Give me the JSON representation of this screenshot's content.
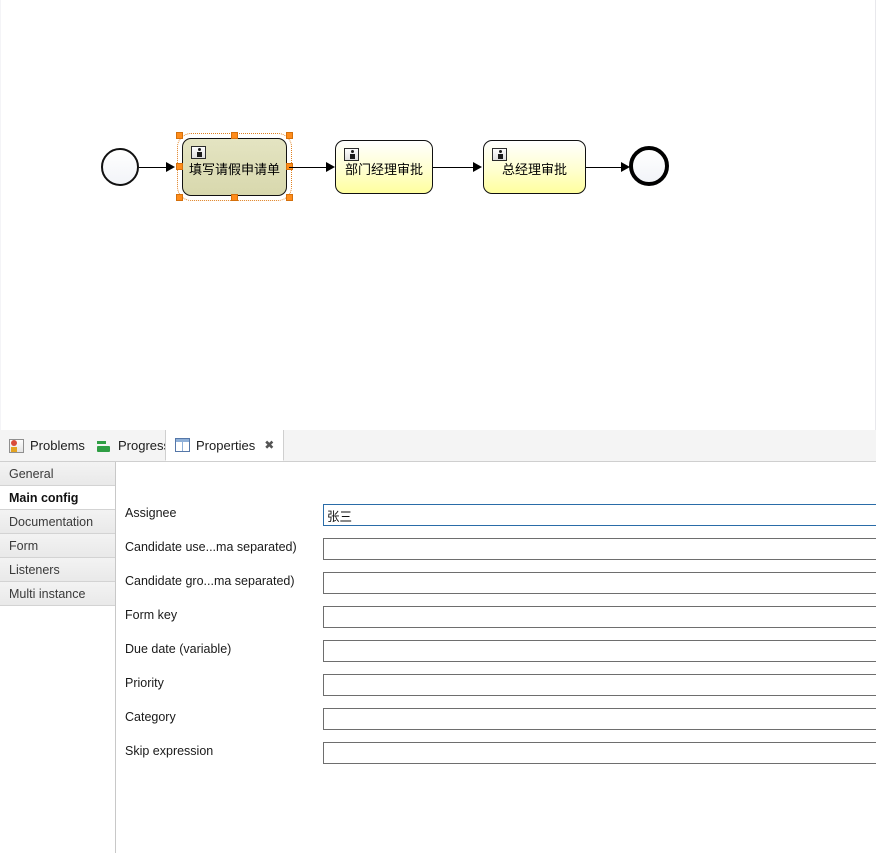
{
  "canvas": {
    "name": "bpmn-process-diagram",
    "start_event": {
      "label": "",
      "icon": "start-event-icon"
    },
    "end_event": {
      "label": "",
      "icon": "end-event-icon"
    },
    "tasks": [
      {
        "label": "填写请假申请单",
        "icon": "user-task-icon",
        "selected": true
      },
      {
        "label": "部门经理审批",
        "icon": "user-task-icon",
        "selected": false
      },
      {
        "label": "总经理审批",
        "icon": "user-task-icon",
        "selected": false
      }
    ],
    "colors": {
      "task_fill_top": "#ffffff",
      "task_fill_bottom": "#ffff9e",
      "task_selected_fill": "#d8d8ad",
      "selection_handle": "#ff8c1a",
      "connector": "#000000"
    }
  },
  "tabs": [
    {
      "label": "Problems",
      "icon": "problems-icon",
      "active": false,
      "closable": false
    },
    {
      "label": "Progress",
      "icon": "progress-icon",
      "active": false,
      "closable": false
    },
    {
      "label": "Properties",
      "icon": "properties-icon",
      "active": true,
      "closable": true,
      "close_glyph": "✖"
    }
  ],
  "properties": {
    "sidebar": {
      "items": [
        {
          "label": "General",
          "selected": false
        },
        {
          "label": "Main config",
          "selected": true
        },
        {
          "label": "Documentation",
          "selected": false
        },
        {
          "label": "Form",
          "selected": false
        },
        {
          "label": "Listeners",
          "selected": false
        },
        {
          "label": "Multi instance",
          "selected": false
        }
      ]
    },
    "fields": [
      {
        "label": "Assignee",
        "value": "张三",
        "placeholder": "",
        "focused": true
      },
      {
        "label": "Candidate use...ma separated)",
        "value": "",
        "placeholder": "",
        "focused": false
      },
      {
        "label": "Candidate gro...ma separated)",
        "value": "",
        "placeholder": "",
        "focused": false
      },
      {
        "label": "Form key",
        "value": "",
        "placeholder": "",
        "focused": false
      },
      {
        "label": "Due date (variable)",
        "value": "",
        "placeholder": "",
        "focused": false
      },
      {
        "label": "Priority",
        "value": "",
        "placeholder": "",
        "focused": false
      },
      {
        "label": "Category",
        "value": "",
        "placeholder": "",
        "focused": false
      },
      {
        "label": "Skip expression",
        "value": "",
        "placeholder": "",
        "focused": false
      }
    ]
  }
}
